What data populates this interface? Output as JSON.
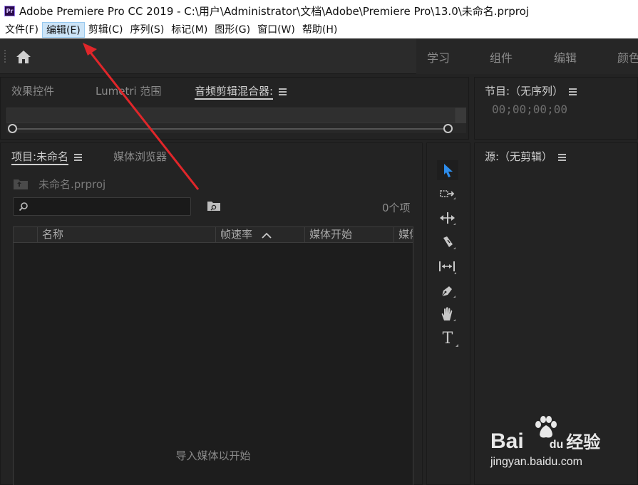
{
  "window": {
    "app_icon_label": "Pr",
    "title": "Adobe Premiere Pro CC 2019 - C:\\用户\\Administrator\\文档\\Adobe\\Premiere Pro\\13.0\\未命名.prproj"
  },
  "menu": [
    {
      "label": "文件(F)"
    },
    {
      "label": "编辑(E)"
    },
    {
      "label": "剪辑(C)"
    },
    {
      "label": "序列(S)"
    },
    {
      "label": "标记(M)"
    },
    {
      "label": "图形(G)"
    },
    {
      "label": "窗口(W)"
    },
    {
      "label": "帮助(H)"
    }
  ],
  "workspaces": [
    "学习",
    "组件",
    "编辑",
    "颜色"
  ],
  "effects_panel": {
    "tabs": [
      "效果控件",
      "Lumetri 范围",
      "音频剪辑混合器:"
    ]
  },
  "program_panel": {
    "title": "节目:（无序列）",
    "timecode": "00;00;00;00"
  },
  "project_panel": {
    "tabs": [
      "项目:未命名",
      "媒体浏览器"
    ],
    "file_name": "未命名.prproj",
    "search_placeholder": "",
    "item_count": "0个项",
    "columns": [
      "名称",
      "帧速率",
      "媒体开始",
      "媒体"
    ],
    "empty_hint": "导入媒体以开始"
  },
  "source_panel": {
    "title": "源:（无剪辑）"
  },
  "tools": [
    "selection-tool",
    "track-select-tool",
    "ripple-edit-tool",
    "razor-tool",
    "slip-tool",
    "pen-tool",
    "hand-tool",
    "type-tool"
  ],
  "tool_glyphs": {
    "type": "T"
  },
  "watermark": {
    "brand": "Bai",
    "brand_tail": "du",
    "brand_cn": "经验",
    "url": "jingyan.baidu.com"
  },
  "colors": {
    "annotation_arrow": "#e0262a",
    "accent_blue": "#2d8ceb"
  }
}
